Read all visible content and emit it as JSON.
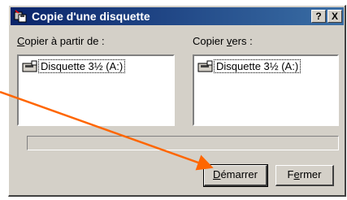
{
  "window": {
    "title": "Copie d'une disquette",
    "help_label": "?",
    "close_label": "X"
  },
  "source": {
    "label_pre": "",
    "label_ul": "C",
    "label_post": "opier à partir de :",
    "item": "Disquette 3½ (A:)"
  },
  "destination": {
    "label_pre": "Copier ",
    "label_ul": "v",
    "label_post": "ers :",
    "item": "Disquette 3½ (A:)"
  },
  "progress": {
    "value": 0
  },
  "buttons": {
    "start_pre": "",
    "start_ul": "D",
    "start_post": "émarrer",
    "close_pre": "F",
    "close_ul": "e",
    "close_post": "rmer"
  },
  "colors": {
    "titlebar_start": "#0a246a",
    "titlebar_end": "#3a6ea5",
    "annotation_arrow": "#ff6600"
  },
  "icons": {
    "title": "floppy-copy-icon",
    "drive": "floppy-drive-icon"
  }
}
